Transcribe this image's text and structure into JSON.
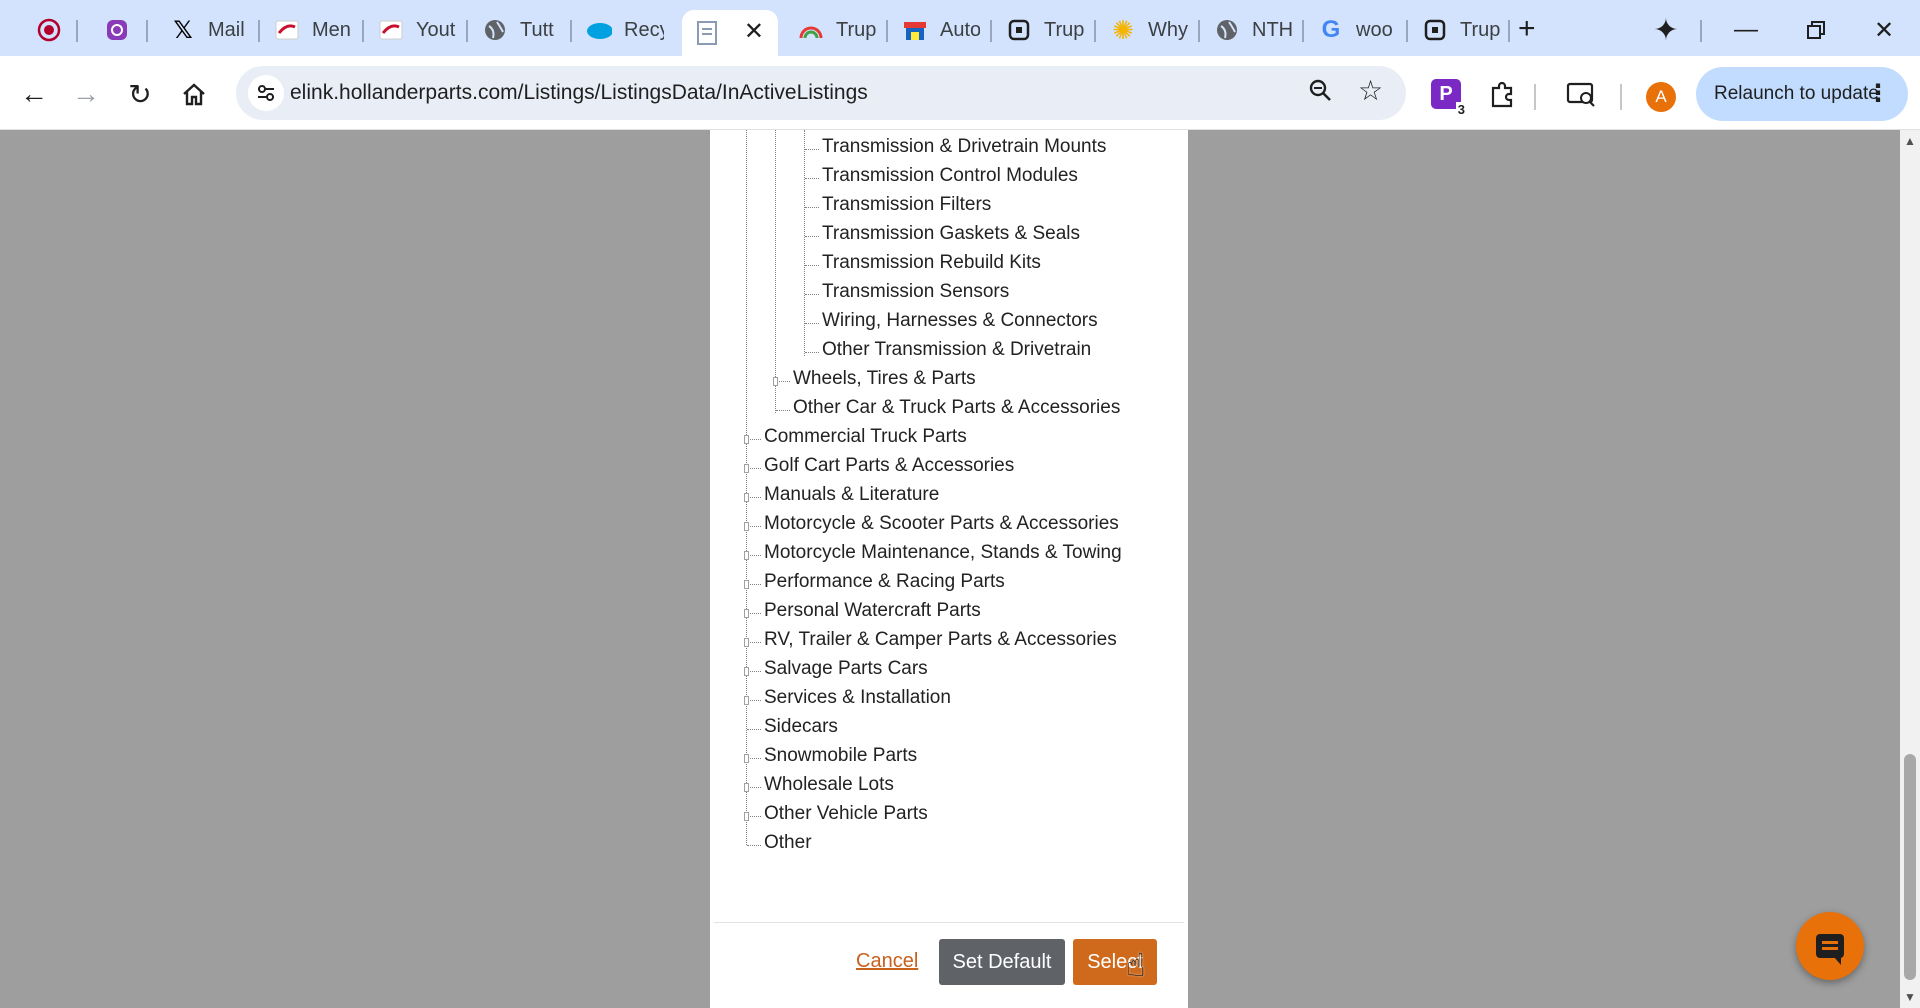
{
  "tabs": [
    {
      "title": "",
      "icon": "record-icon"
    },
    {
      "title": "",
      "icon": "instagram-icon"
    },
    {
      "title": "Mail",
      "icon": "x-icon"
    },
    {
      "title": "Men",
      "icon": "hollander-icon"
    },
    {
      "title": "Yout",
      "icon": "hollander-icon"
    },
    {
      "title": "Tutt",
      "icon": "globe-icon"
    },
    {
      "title": "Recy",
      "icon": "salesforce-icon"
    },
    {
      "title": "",
      "icon": "document-icon",
      "active": true
    },
    {
      "title": "Trup",
      "icon": "rainbow-icon"
    },
    {
      "title": "Auto",
      "icon": "store-icon"
    },
    {
      "title": "Trup",
      "icon": "box-icon"
    },
    {
      "title": "Why",
      "icon": "sun-icon"
    },
    {
      "title": "NTH",
      "icon": "globe-icon"
    },
    {
      "title": "woo",
      "icon": "google-icon"
    },
    {
      "title": "Trup",
      "icon": "box-icon"
    }
  ],
  "address_bar": {
    "url": "elink.hollanderparts.com/Listings/ListingsData/InActiveListings"
  },
  "extensions": {
    "badge_count": "3",
    "profile_initial": "A"
  },
  "relaunch_label": "Relaunch to update",
  "category_tree": {
    "level3": [
      "Transmission & Drivetrain Mounts",
      "Transmission Control Modules",
      "Transmission Filters",
      "Transmission Gaskets & Seals",
      "Transmission Rebuild Kits",
      "Transmission Sensors",
      "Wiring, Harnesses & Connectors",
      "Other Transmission & Drivetrain"
    ],
    "level2": [
      "Wheels, Tires & Parts",
      "Other Car & Truck Parts & Accessories"
    ],
    "level1": [
      "Commercial Truck Parts",
      "Golf Cart Parts & Accessories",
      "Manuals & Literature",
      "Motorcycle & Scooter Parts & Accessories",
      "Motorcycle Maintenance, Stands & Towing",
      "Performance & Racing Parts",
      "Personal Watercraft Parts",
      "RV, Trailer & Camper Parts & Accessories",
      "Salvage Parts Cars",
      "Services & Installation",
      "Sidecars",
      "Snowmobile Parts",
      "Wholesale Lots",
      "Other Vehicle Parts",
      "Other"
    ]
  },
  "footer": {
    "cancel_label": "Cancel",
    "set_default_label": "Set Default",
    "select_label": "Select"
  },
  "colors": {
    "accent": "#cf6a1d",
    "secondary_button": "#5f6368",
    "chat_button": "#e8710a"
  }
}
